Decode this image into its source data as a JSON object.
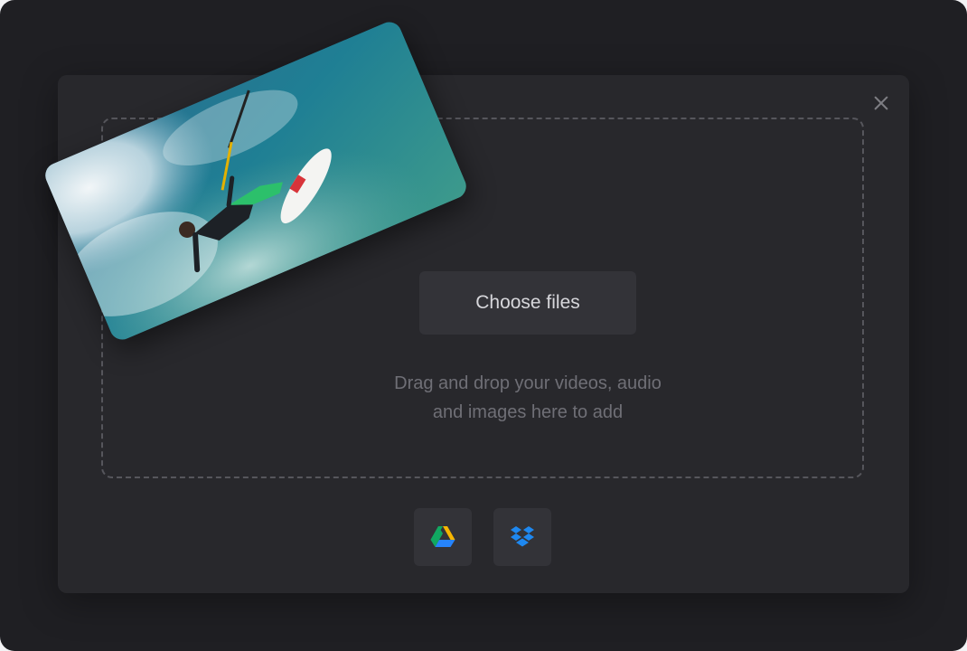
{
  "dialog": {
    "choose_files_label": "Choose files",
    "hint_line1": "Drag and drop your videos, audio",
    "hint_line2": "and images here to add"
  },
  "icons": {
    "close": "close-icon",
    "google_drive": "google-drive-icon",
    "dropbox": "dropbox-icon"
  },
  "colors": {
    "background": "#1f1f23",
    "modal": "#28282c",
    "button": "#333338",
    "dropbox_blue": "#0061fe"
  }
}
